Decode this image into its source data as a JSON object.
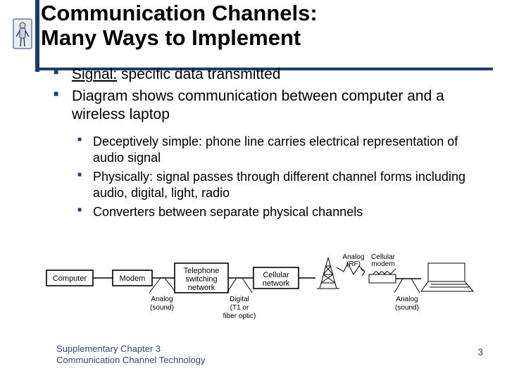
{
  "header": {
    "title_line1": "Communication Channels:",
    "title_line2": "Many Ways to Implement"
  },
  "bullets_l1": [
    {
      "lead": "Signal:",
      "rest": " specific data transmitted"
    },
    {
      "lead": "",
      "rest": "Diagram shows communication between computer and a wireless laptop"
    }
  ],
  "bullets_l2": [
    "Deceptively simple: phone line carries electrical representation of audio signal",
    "Physically: signal passes through different channel forms including audio, digital, light, radio",
    "Converters between separate physical channels"
  ],
  "diagram": {
    "boxes": {
      "computer": "Computer",
      "modem": "Modem",
      "telephone1": "Telephone",
      "telephone2": "switching",
      "telephone3": "network",
      "cellular1": "Cellular",
      "cellular2": "network",
      "cellmodem1": "Cellular",
      "cellmodem2": "modem"
    },
    "links": {
      "analog1a": "Analog",
      "analog1b": "(sound)",
      "digital1": "Digital",
      "digital2": "(T1 or",
      "digital3": "fiber optic)",
      "rf1": "Analog",
      "rf2": "(RF)",
      "analog2a": "Analog",
      "analog2b": "(sound)"
    }
  },
  "footer": {
    "line1": "Supplementary Chapter 3",
    "line2": "Communication Channel Technology",
    "page": "3"
  }
}
